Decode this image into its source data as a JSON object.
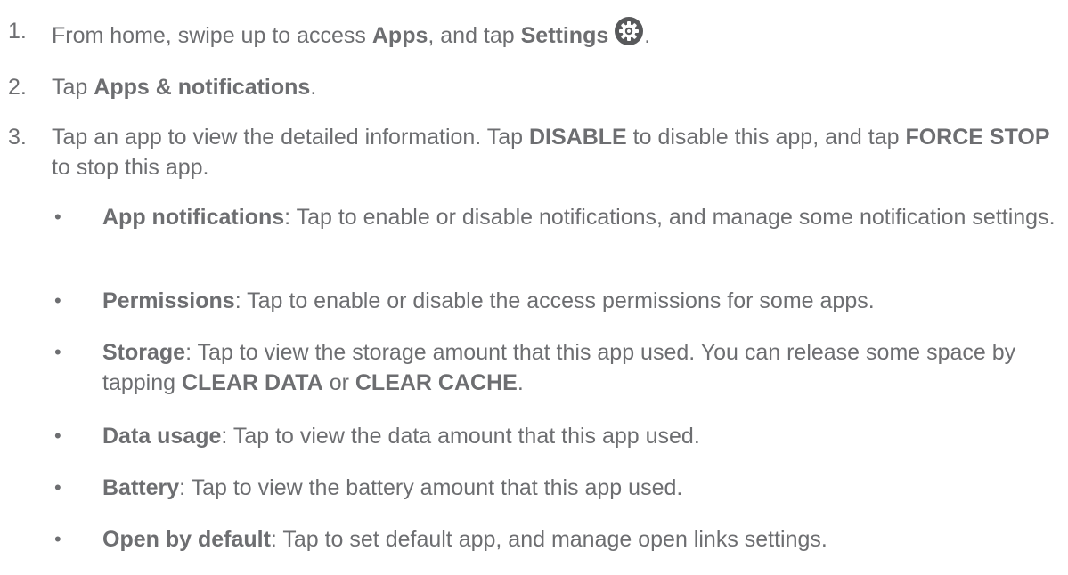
{
  "steps": [
    {
      "number": "1.",
      "parts": [
        {
          "t": "From home, swipe up to access ",
          "b": false
        },
        {
          "t": "Apps",
          "b": true
        },
        {
          "t": ", and tap ",
          "b": false
        },
        {
          "t": "Settings",
          "b": true
        }
      ],
      "icon": "gear-icon",
      "trailing": "."
    },
    {
      "number": "2.",
      "parts": [
        {
          "t": "Tap ",
          "b": false
        },
        {
          "t": "Apps & notifications",
          "b": true
        },
        {
          "t": ".",
          "b": false
        }
      ]
    },
    {
      "number": "3.",
      "parts": [
        {
          "t": "Tap an app to view the detailed information. Tap ",
          "b": false
        },
        {
          "t": "DISABLE",
          "b": true
        },
        {
          "t": " to disable this app, and tap ",
          "b": false
        },
        {
          "t": "FORCE STOP",
          "b": true
        },
        {
          "t": " to stop this app.",
          "b": false
        }
      ]
    }
  ],
  "bullets": [
    {
      "bullet": "•",
      "parts": [
        {
          "t": "App notifications",
          "b": true
        },
        {
          "t": ": Tap to enable or disable notifications, and manage some notification settings.",
          "b": false
        }
      ]
    },
    {
      "bullet": "•",
      "parts": [
        {
          "t": "Permissions",
          "b": true
        },
        {
          "t": ": Tap to enable or disable the access permissions for some apps.",
          "b": false
        }
      ]
    },
    {
      "bullet": "•",
      "parts": [
        {
          "t": "Storage",
          "b": true
        },
        {
          "t": ": Tap to view the storage amount that this app used. You can release some space by tapping ",
          "b": false
        },
        {
          "t": "CLEAR DATA",
          "b": true
        },
        {
          "t": " or ",
          "b": false
        },
        {
          "t": "CLEAR CACHE",
          "b": true
        },
        {
          "t": ".",
          "b": false
        }
      ]
    },
    {
      "bullet": "•",
      "parts": [
        {
          "t": "Data usage",
          "b": true
        },
        {
          "t": ": Tap to view the data amount that this app used.",
          "b": false
        }
      ]
    },
    {
      "bullet": "•",
      "parts": [
        {
          "t": "Battery",
          "b": true
        },
        {
          "t": ": Tap to view the battery amount that this app used.",
          "b": false
        }
      ]
    },
    {
      "bullet": "•",
      "parts": [
        {
          "t": "Open by default",
          "b": true
        },
        {
          "t": ": Tap to set default app, and manage open links settings.",
          "b": false
        }
      ]
    }
  ],
  "colors": {
    "text": "#6d6e71",
    "icon_bg": "#58595b",
    "icon_fg": "#ffffff"
  }
}
